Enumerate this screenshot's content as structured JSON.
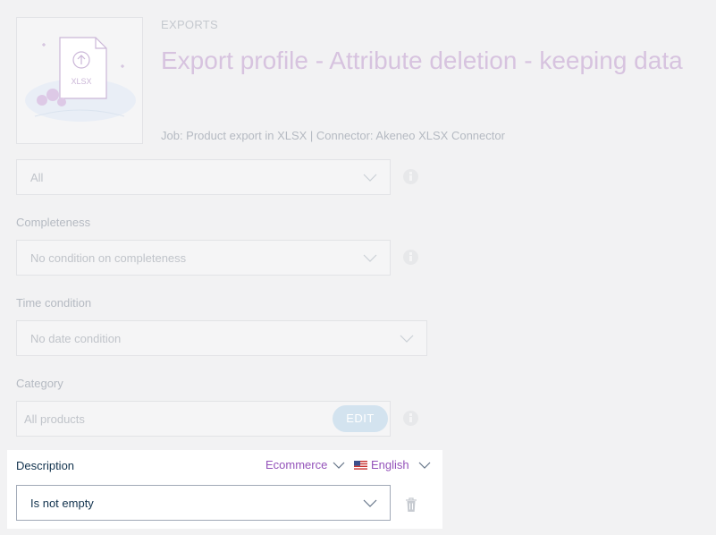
{
  "header": {
    "breadcrumb": "EXPORTS",
    "title": "Export profile - Attribute deletion - keeping data",
    "subtitle": "Job: Product export in XLSX | Connector: Akeneo XLSX Connector",
    "illustration_label": "XLSX"
  },
  "filters": {
    "status": {
      "value": "All"
    },
    "completeness": {
      "label": "Completeness",
      "value": "No condition on completeness"
    },
    "time": {
      "label": "Time condition",
      "value": "No date condition"
    },
    "category": {
      "label": "Category",
      "value": "All products",
      "edit_label": "EDIT"
    }
  },
  "active_filter": {
    "label": "Description",
    "scope": "Ecommerce",
    "locale": "English",
    "operator": "Is not empty"
  },
  "colors": {
    "accent": "#9452ba",
    "text_dark": "#11324d",
    "edit_button": "#d3e3ef"
  }
}
